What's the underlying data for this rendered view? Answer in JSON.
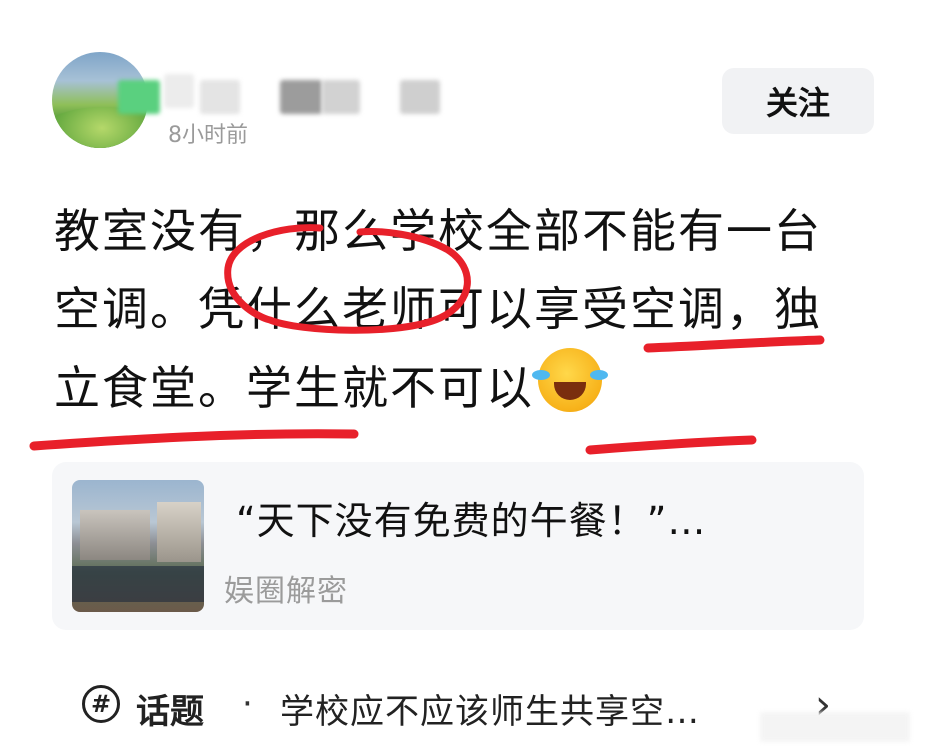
{
  "header": {
    "time": "8小时前",
    "follow_label": "关注",
    "avatar_icon": "avatar-landscape"
  },
  "post": {
    "seg1": "教室没有，那么学校全部不能有一台空调。凭什么老师可以享受空调，独立食堂。学生就不可以",
    "emoji": "laughing-crying-emoji"
  },
  "card": {
    "title": "“天下没有免费的午餐！”…",
    "source": "娱圈解密"
  },
  "topic": {
    "icon": "#",
    "label": "话题",
    "dot": "·",
    "text": "学校应不应该师生共享空…",
    "chevron": "›"
  },
  "colors": {
    "annotation_red": "#e8202a",
    "follow_bg": "#f1f2f4",
    "card_bg": "#f6f7f9"
  }
}
